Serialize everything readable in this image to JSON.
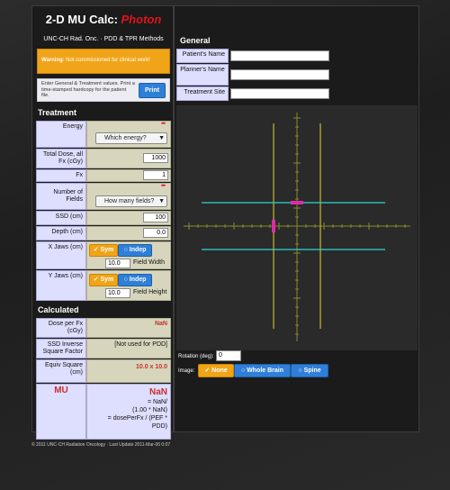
{
  "app": {
    "title_prefix": "2-D MU Calc: ",
    "title_accent": "Photon",
    "subtitle": "UNC-CH Rad. Onc. · PDD & TPR Methods"
  },
  "warning": {
    "bold": "Warning",
    "text": ": Not commissioned for clinical work!"
  },
  "info": {
    "text": "Enter General & Treatment values. Print a time-stamped hardcopy for the patient file.",
    "print_label": "Print"
  },
  "general": {
    "heading": "General",
    "patient_name_label": "Patient's Name",
    "patient_name_value": "",
    "planner_label": "Planner's Name",
    "planner_value": "",
    "site_label": "Treatment Site",
    "site_value": ""
  },
  "treatment": {
    "heading": "Treatment",
    "energy_label": "Energy",
    "energy_select": "Which energy?",
    "required_mark": "***",
    "total_dose_label": "Total Dose, all Fx (cGy)",
    "total_dose_value": "1000",
    "fx_label": "Fx",
    "fx_value": "1",
    "num_fields_label": "Number of Fields",
    "num_fields_select": "How many fields?",
    "ssd_label": "SSD (cm)",
    "ssd_value": "100",
    "depth_label": "Depth (cm)",
    "depth_value": "0.0",
    "xjaws_label": "X Jaws (cm)",
    "yjaws_label": "Y Jaws (cm)",
    "sym_label": "Sym",
    "indep_label": "Indep",
    "field_width_value": "10.0",
    "field_width_label": "Field Width",
    "field_height_value": "10.0",
    "field_height_label": "Field Height"
  },
  "calculated": {
    "heading": "Calculated",
    "dose_per_fx_label": "Dose per Fx (cGy)",
    "dose_per_fx_value": "NaN",
    "ssd_isf_label": "SSD Inverse Square Factor",
    "ssd_isf_value": "[Not used for PDD]",
    "equiv_sq_label": "Equiv Square (cm)",
    "equiv_sq_value": "10.0 x 10.0",
    "mu_label": "MU",
    "mu_value": "NaN",
    "mu_formula_1": "= NaN/",
    "mu_formula_2": "(1.00 * NaN)",
    "mu_formula_3": "= dosePerFx / (PEF *",
    "mu_formula_4": "PDD)"
  },
  "view": {
    "rotation_label": "Rotation (deg):",
    "rotation_value": "0",
    "image_label": "Image:",
    "image_options": [
      "None",
      "Whole Brain",
      "Spine"
    ],
    "selected_image": "None",
    "colors": {
      "field_edge": "#2ad6d0",
      "jaw_line": "#c8b832",
      "center": "#e02aa8",
      "axis": "#8a8a2a"
    }
  },
  "footer": "© 2011 UNC-CH Radiation Oncology · Last Update 2011-Mar-06 0:07"
}
